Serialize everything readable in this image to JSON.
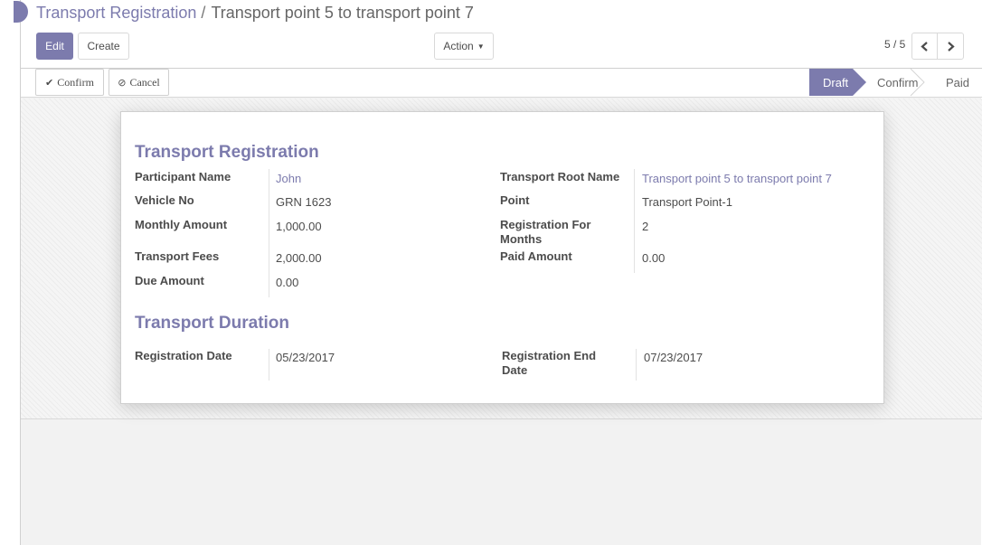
{
  "breadcrumb": {
    "parent": "Transport Registration",
    "separator": "/",
    "current": "Transport point 5 to transport point 7"
  },
  "toolbar": {
    "edit_label": "Edit",
    "create_label": "Create",
    "action_label": "Action",
    "pager": "5 / 5"
  },
  "statusbar": {
    "confirm_label": "Confirm",
    "cancel_label": "Cancel",
    "stages": [
      "Draft",
      "Confirm",
      "Paid"
    ],
    "active_stage": "Draft"
  },
  "form": {
    "section1_title": "Transport Registration",
    "participant_name_label": "Participant Name",
    "participant_name": "John",
    "vehicle_no_label": "Vehicle No",
    "vehicle_no": "GRN 1623",
    "monthly_amount_label": "Monthly Amount",
    "monthly_amount": "1,000.00",
    "transport_fees_label": "Transport Fees",
    "transport_fees": "2,000.00",
    "due_amount_label": "Due Amount",
    "due_amount": "0.00",
    "transport_root_name_label": "Transport Root Name",
    "transport_root_name": "Transport point 5 to transport point 7",
    "point_label": "Point",
    "point": "Transport Point-1",
    "registration_for_months_label": "Registration For Months",
    "registration_for_months": "2",
    "paid_amount_label": "Paid Amount",
    "paid_amount": "0.00",
    "section2_title": "Transport Duration",
    "registration_date_label": "Registration Date",
    "registration_date": "05/23/2017",
    "registration_end_date_label": "Registration End Date",
    "registration_end_date": "07/23/2017"
  },
  "colors": {
    "accent": "#7c7bad"
  }
}
